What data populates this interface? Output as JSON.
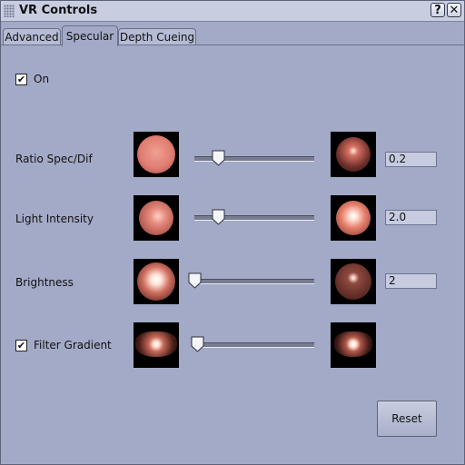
{
  "window": {
    "title": "VR Controls"
  },
  "titlebar": {
    "help_label": "?",
    "close_label": "✕"
  },
  "tabs": [
    {
      "label": "Advanced",
      "active": false
    },
    {
      "label": "Specular",
      "active": true
    },
    {
      "label": "Depth Cueing",
      "active": false
    }
  ],
  "on_checkbox": {
    "label": "On",
    "checked": true,
    "mark": "✔"
  },
  "rows": [
    {
      "label": "Ratio Spec/Dif",
      "value": "0.2",
      "slider_fraction": 0.2
    },
    {
      "label": "Light Intensity",
      "value": "2.0",
      "slider_fraction": 0.2
    },
    {
      "label": "Brightness",
      "value": "2",
      "slider_fraction": 0.0
    },
    {
      "label": "Filter Gradient",
      "checked": true,
      "mark": "✔",
      "slider_fraction": 0.02
    }
  ],
  "reset_label": "Reset",
  "colors": {
    "background": "#a3aac7",
    "sphere": "#e8877c",
    "highlight": "#fff2e8"
  }
}
